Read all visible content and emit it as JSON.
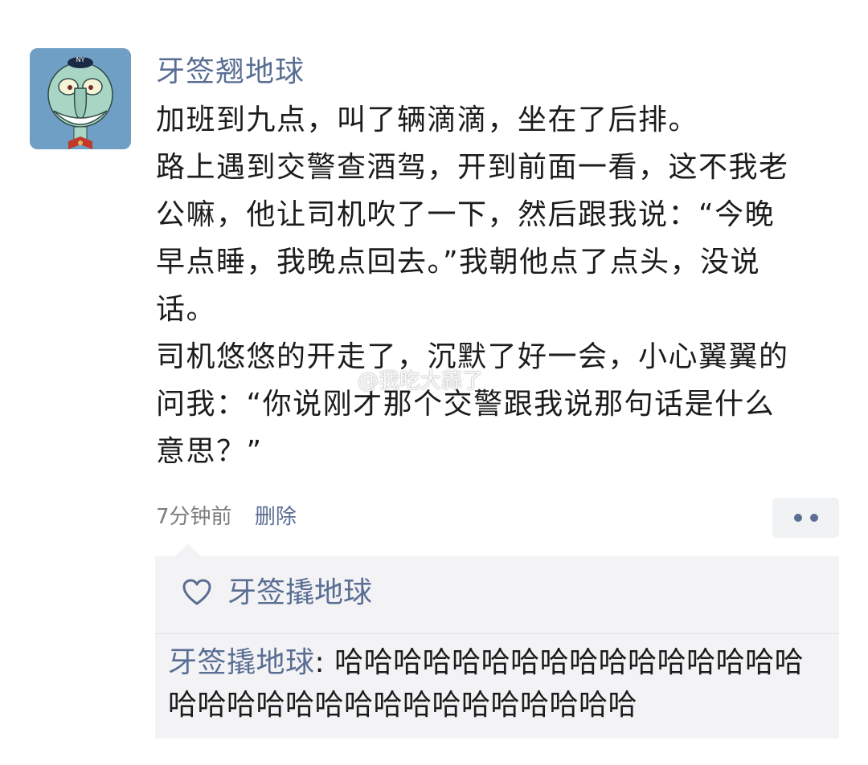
{
  "post": {
    "author": "牙签翘地球",
    "content": [
      "加班到九点，叫了辆滴滴，坐在了后排。",
      "路上遇到交警查酒驾，开到前面一看，这不我老公嘛，他让司机吹了一下，然后跟我说：“今晚早点睡，我晚点回去。”我朝他点了点头，没说话。",
      "司机悠悠的开走了，沉默了好一会，小心翼翼的问我：“你说刚才那个交警跟我说那句话是什么意思？”"
    ],
    "time": "7分钟前",
    "delete_label": "删除"
  },
  "watermark": "@我吃大蒜了",
  "likes": {
    "icon": "heart-outline-icon",
    "names": "牙签撬地球"
  },
  "comments": [
    {
      "author": "牙签撬地球",
      "separator": ": ",
      "text": "哈哈哈哈哈哈哈哈哈哈哈哈哈哈哈哈哈哈哈哈哈哈哈哈哈哈哈哈哈哈哈哈"
    }
  ],
  "colors": {
    "link": "#5a6e94",
    "text": "#1c1c1c",
    "meta": "#7d7d7d",
    "panel": "#f3f3f5"
  }
}
